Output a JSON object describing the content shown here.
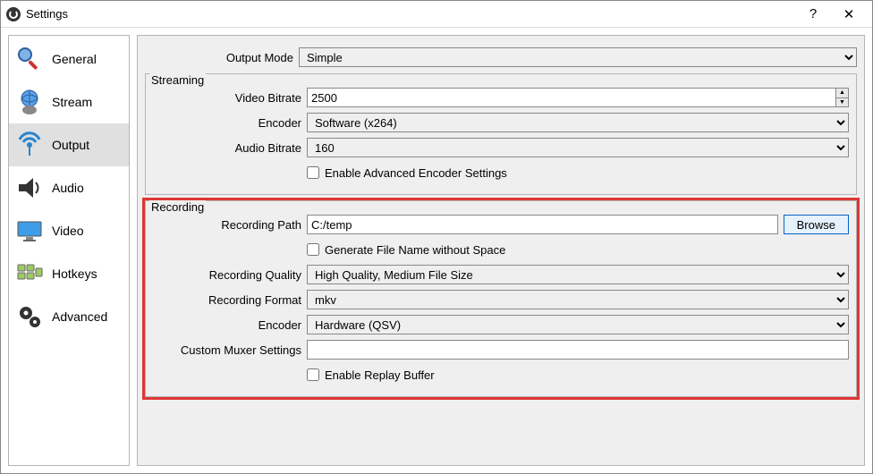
{
  "window": {
    "title": "Settings"
  },
  "sidebar": {
    "items": [
      {
        "label": "General"
      },
      {
        "label": "Stream"
      },
      {
        "label": "Output"
      },
      {
        "label": "Audio"
      },
      {
        "label": "Video"
      },
      {
        "label": "Hotkeys"
      },
      {
        "label": "Advanced"
      }
    ]
  },
  "output": {
    "mode_label": "Output Mode",
    "mode": "Simple",
    "streaming": {
      "legend": "Streaming",
      "vbitrate_label": "Video Bitrate",
      "vbitrate": "2500",
      "encoder_label": "Encoder",
      "encoder": "Software (x264)",
      "abitrate_label": "Audio Bitrate",
      "abitrate": "160",
      "adv_label": "Enable Advanced Encoder Settings"
    },
    "recording": {
      "legend": "Recording",
      "path_label": "Recording Path",
      "path": "C:/temp",
      "browse": "Browse",
      "nospace_label": "Generate File Name without Space",
      "quality_label": "Recording Quality",
      "quality": "High Quality, Medium File Size",
      "format_label": "Recording Format",
      "format": "mkv",
      "encoder_label": "Encoder",
      "encoder": "Hardware (QSV)",
      "muxer_label": "Custom Muxer Settings",
      "muxer": "",
      "replay_label": "Enable Replay Buffer"
    }
  }
}
